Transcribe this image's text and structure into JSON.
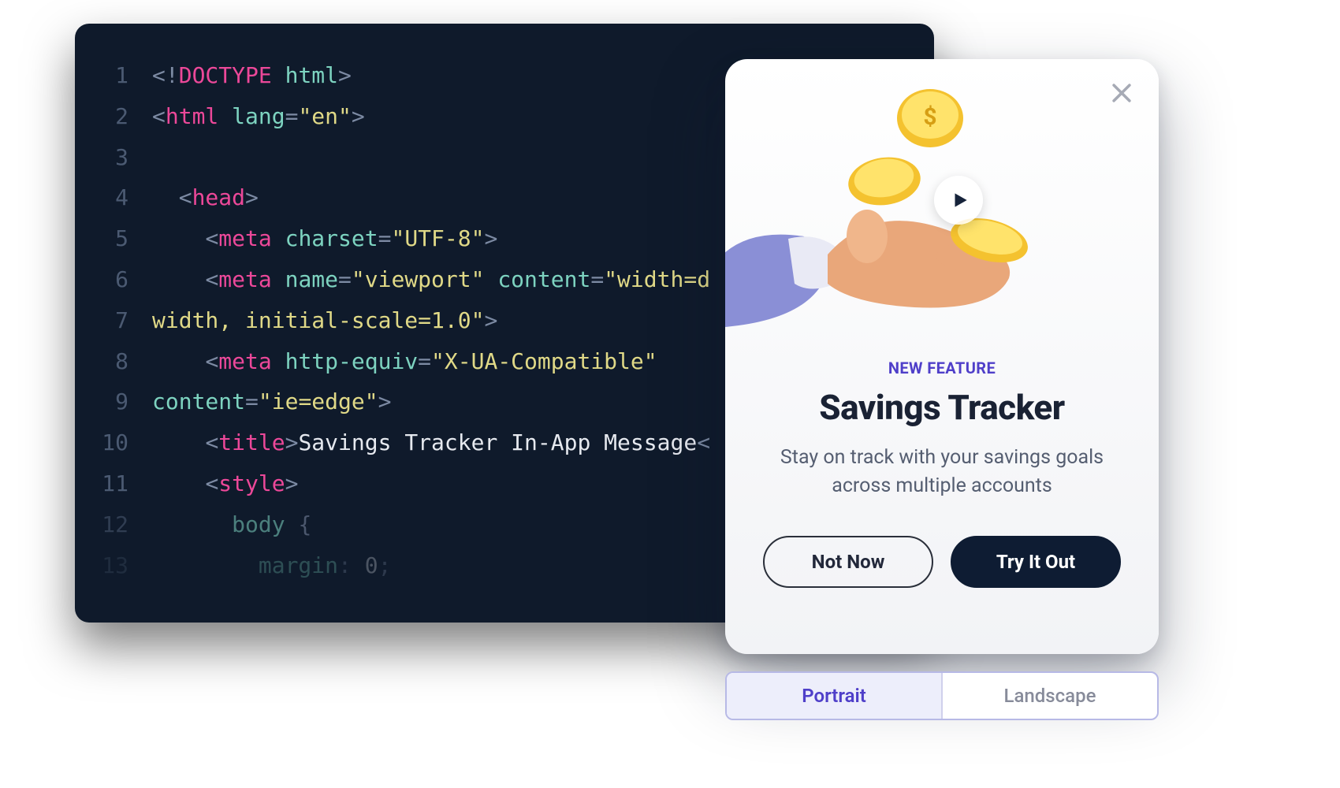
{
  "editor": {
    "lines": [
      {
        "num": "1",
        "tokens": [
          {
            "cls": "punct",
            "t": "<!"
          },
          {
            "cls": "tag",
            "t": "DOCTYPE"
          },
          {
            "cls": "plain",
            "t": " "
          },
          {
            "cls": "attr",
            "t": "html"
          },
          {
            "cls": "punct",
            "t": ">"
          }
        ]
      },
      {
        "num": "2",
        "tokens": [
          {
            "cls": "punct",
            "t": "<"
          },
          {
            "cls": "tag",
            "t": "html"
          },
          {
            "cls": "plain",
            "t": " "
          },
          {
            "cls": "attr",
            "t": "lang"
          },
          {
            "cls": "punct",
            "t": "="
          },
          {
            "cls": "string",
            "t": "\"en\""
          },
          {
            "cls": "punct",
            "t": ">"
          }
        ]
      },
      {
        "num": "3",
        "tokens": []
      },
      {
        "num": "4",
        "tokens": [
          {
            "cls": "plain",
            "t": "  "
          },
          {
            "cls": "punct",
            "t": "<"
          },
          {
            "cls": "tag",
            "t": "head"
          },
          {
            "cls": "punct",
            "t": ">"
          }
        ]
      },
      {
        "num": "5",
        "tokens": [
          {
            "cls": "plain",
            "t": "    "
          },
          {
            "cls": "punct",
            "t": "<"
          },
          {
            "cls": "tag",
            "t": "meta"
          },
          {
            "cls": "plain",
            "t": " "
          },
          {
            "cls": "attr",
            "t": "charset"
          },
          {
            "cls": "punct",
            "t": "="
          },
          {
            "cls": "string",
            "t": "\"UTF-8\""
          },
          {
            "cls": "punct",
            "t": ">"
          }
        ]
      },
      {
        "num": "6",
        "tokens": [
          {
            "cls": "plain",
            "t": "    "
          },
          {
            "cls": "punct",
            "t": "<"
          },
          {
            "cls": "tag",
            "t": "meta"
          },
          {
            "cls": "plain",
            "t": " "
          },
          {
            "cls": "attr",
            "t": "name"
          },
          {
            "cls": "punct",
            "t": "="
          },
          {
            "cls": "string",
            "t": "\"viewport\""
          },
          {
            "cls": "plain",
            "t": " "
          },
          {
            "cls": "attr",
            "t": "content"
          },
          {
            "cls": "punct",
            "t": "="
          },
          {
            "cls": "string",
            "t": "\"width=d"
          }
        ]
      },
      {
        "num": "7",
        "tokens": [
          {
            "cls": "string",
            "t": "width, initial-scale=1.0\""
          },
          {
            "cls": "punct",
            "t": ">"
          }
        ]
      },
      {
        "num": "8",
        "tokens": [
          {
            "cls": "plain",
            "t": "    "
          },
          {
            "cls": "punct",
            "t": "<"
          },
          {
            "cls": "tag",
            "t": "meta"
          },
          {
            "cls": "plain",
            "t": " "
          },
          {
            "cls": "attr",
            "t": "http-equiv"
          },
          {
            "cls": "punct",
            "t": "="
          },
          {
            "cls": "string",
            "t": "\"X-UA-Compatible\""
          }
        ]
      },
      {
        "num": "9",
        "tokens": [
          {
            "cls": "attr",
            "t": "content"
          },
          {
            "cls": "punct",
            "t": "="
          },
          {
            "cls": "string",
            "t": "\"ie=edge\""
          },
          {
            "cls": "punct",
            "t": ">"
          }
        ]
      },
      {
        "num": "10",
        "tokens": [
          {
            "cls": "plain",
            "t": "    "
          },
          {
            "cls": "punct",
            "t": "<"
          },
          {
            "cls": "tag",
            "t": "title"
          },
          {
            "cls": "punct",
            "t": ">"
          },
          {
            "cls": "plain",
            "t": "Savings Tracker In-App Message"
          },
          {
            "cls": "punct",
            "t": "<"
          }
        ]
      },
      {
        "num": "11",
        "tokens": [
          {
            "cls": "plain",
            "t": "    "
          },
          {
            "cls": "punct",
            "t": "<"
          },
          {
            "cls": "tag",
            "t": "style"
          },
          {
            "cls": "punct",
            "t": ">"
          }
        ]
      },
      {
        "num": "12",
        "fade": "fade-12",
        "tokens": [
          {
            "cls": "plain",
            "t": "      "
          },
          {
            "cls": "attr",
            "t": "body"
          },
          {
            "cls": "plain",
            "t": " "
          },
          {
            "cls": "punct",
            "t": "{"
          }
        ]
      },
      {
        "num": "13",
        "fade": "fade-13",
        "tokens": [
          {
            "cls": "plain",
            "t": "        "
          },
          {
            "cls": "attr",
            "t": "margin"
          },
          {
            "cls": "punct",
            "t": ": "
          },
          {
            "cls": "plain",
            "t": "0"
          },
          {
            "cls": "punct",
            "t": ";"
          }
        ]
      }
    ]
  },
  "modal": {
    "kicker": "NEW FEATURE",
    "title": "Savings Tracker",
    "description": "Stay on track with your savings goals across multiple accounts",
    "secondary_label": "Not Now",
    "primary_label": "Try It Out",
    "illustration_name": "hand-coins-illustration"
  },
  "toggle": {
    "options": [
      "Portrait",
      "Landscape"
    ],
    "active_index": 0
  }
}
